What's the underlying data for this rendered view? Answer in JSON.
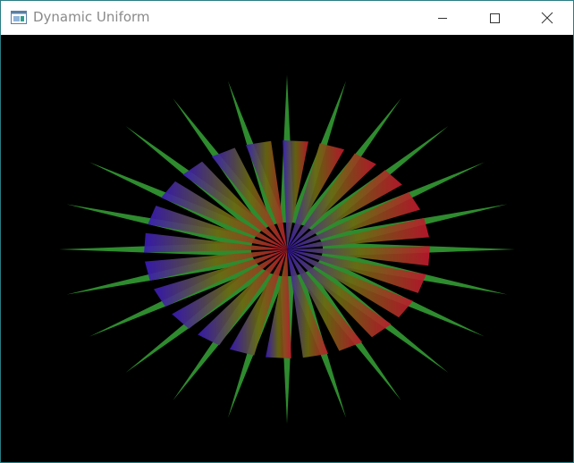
{
  "window": {
    "title": "Dynamic Uniform",
    "controls": {
      "minimize_icon": "minimize-icon",
      "maximize_icon": "maximize-icon",
      "close_icon": "close-icon"
    }
  },
  "scene": {
    "background": "#000000",
    "colors": {
      "spike_green": "#2e8b2e",
      "blade_red": "#c0182e",
      "blade_blue": "#3a1ab8",
      "blade_center_olive": "#6a6a10"
    }
  }
}
